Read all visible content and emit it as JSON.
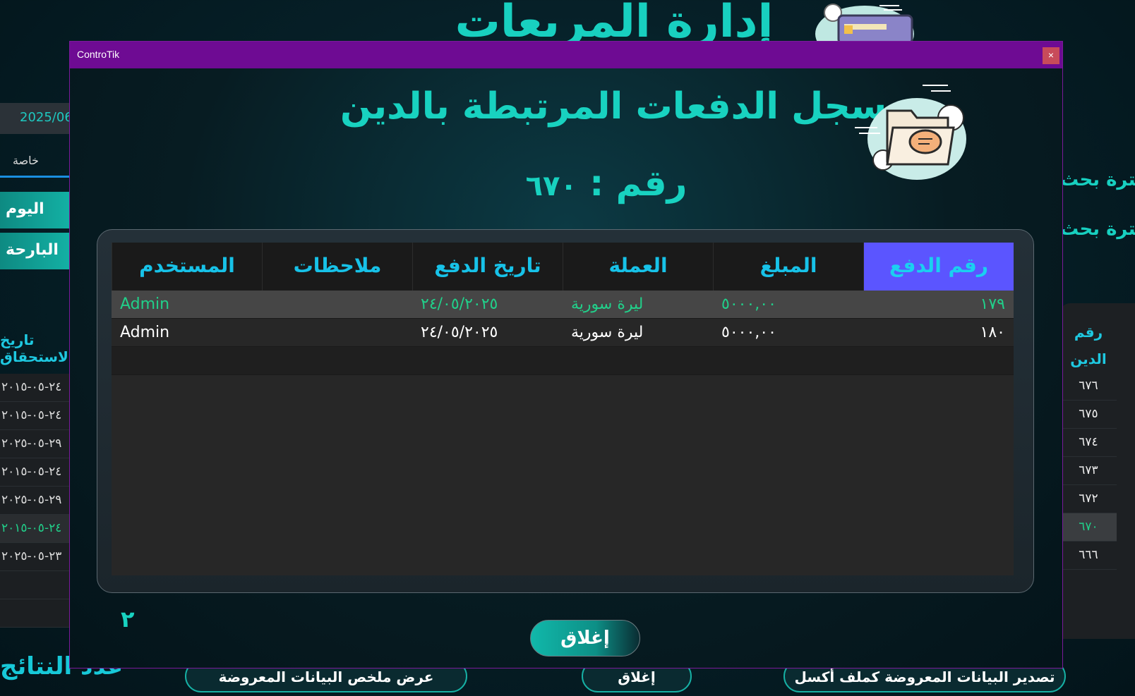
{
  "background": {
    "title": "إدارة المربعات",
    "date_value": "2025/06",
    "special_label": "خاصة",
    "today_button": "اليوم",
    "yesterday_button": "البارحة",
    "filter_label_1": "فلترة بحث",
    "filter_label_2": "فلترة بحث",
    "left_column_header": "تاريخ الاستحقاق",
    "left_rows": [
      "٢٤-٠٥-٢٠١٥",
      "٢٤-٠٥-٢٠١٥",
      "٢٩-٠٥-٢٠٢٥",
      "٢٤-٠٥-٢٠١٥",
      "٢٩-٠٥-٢٠٢٥",
      "٢٤-٠٥-٢٠١٥",
      "٢٣-٠٥-٢٠٢٥"
    ],
    "right_column_header_1": "رقم",
    "right_column_header_2": "الدين",
    "right_rows": [
      "٦٧٦",
      "٦٧٥",
      "٦٧٤",
      "٦٧٣",
      "٦٧٢",
      "٦٧٠",
      "٦٦٦"
    ],
    "results_count_label": "عدد النتائج",
    "summary_button": "عرض ملخص البيانات المعروضة",
    "close_button": "إغلاق",
    "export_button": "تصدير البيانات المعروضة كملف أكسل"
  },
  "dialog": {
    "window_title": "ControTik",
    "close_glyph": "×",
    "heading": "سجل الدفعات المرتبطة بالدين",
    "number_label": "رقم :",
    "number_value": "٦٧٠",
    "table": {
      "columns": [
        "رقم الدفع",
        "المبلغ",
        "العملة",
        "تاريخ الدفع",
        "ملاحظات",
        "المستخدم"
      ],
      "rows": [
        {
          "payment_no": "١٧٩",
          "amount": "٥٠٠٠,٠٠",
          "currency": "ليرة سورية",
          "date": "٢٤/٠٥/٢٠٢٥",
          "notes": "",
          "user": "Admin"
        },
        {
          "payment_no": "١٨٠",
          "amount": "٥٠٠٠,٠٠",
          "currency": "ليرة سورية",
          "date": "٢٤/٠٥/٢٠٢٥",
          "notes": "",
          "user": "Admin"
        }
      ]
    },
    "row_count": "٢",
    "close_button": "إغلاق"
  },
  "colors": {
    "accent": "#18d2c0",
    "titlebar": "#6e0b93",
    "active_header": "#5b55ff",
    "selected_text": "#21d08a"
  }
}
